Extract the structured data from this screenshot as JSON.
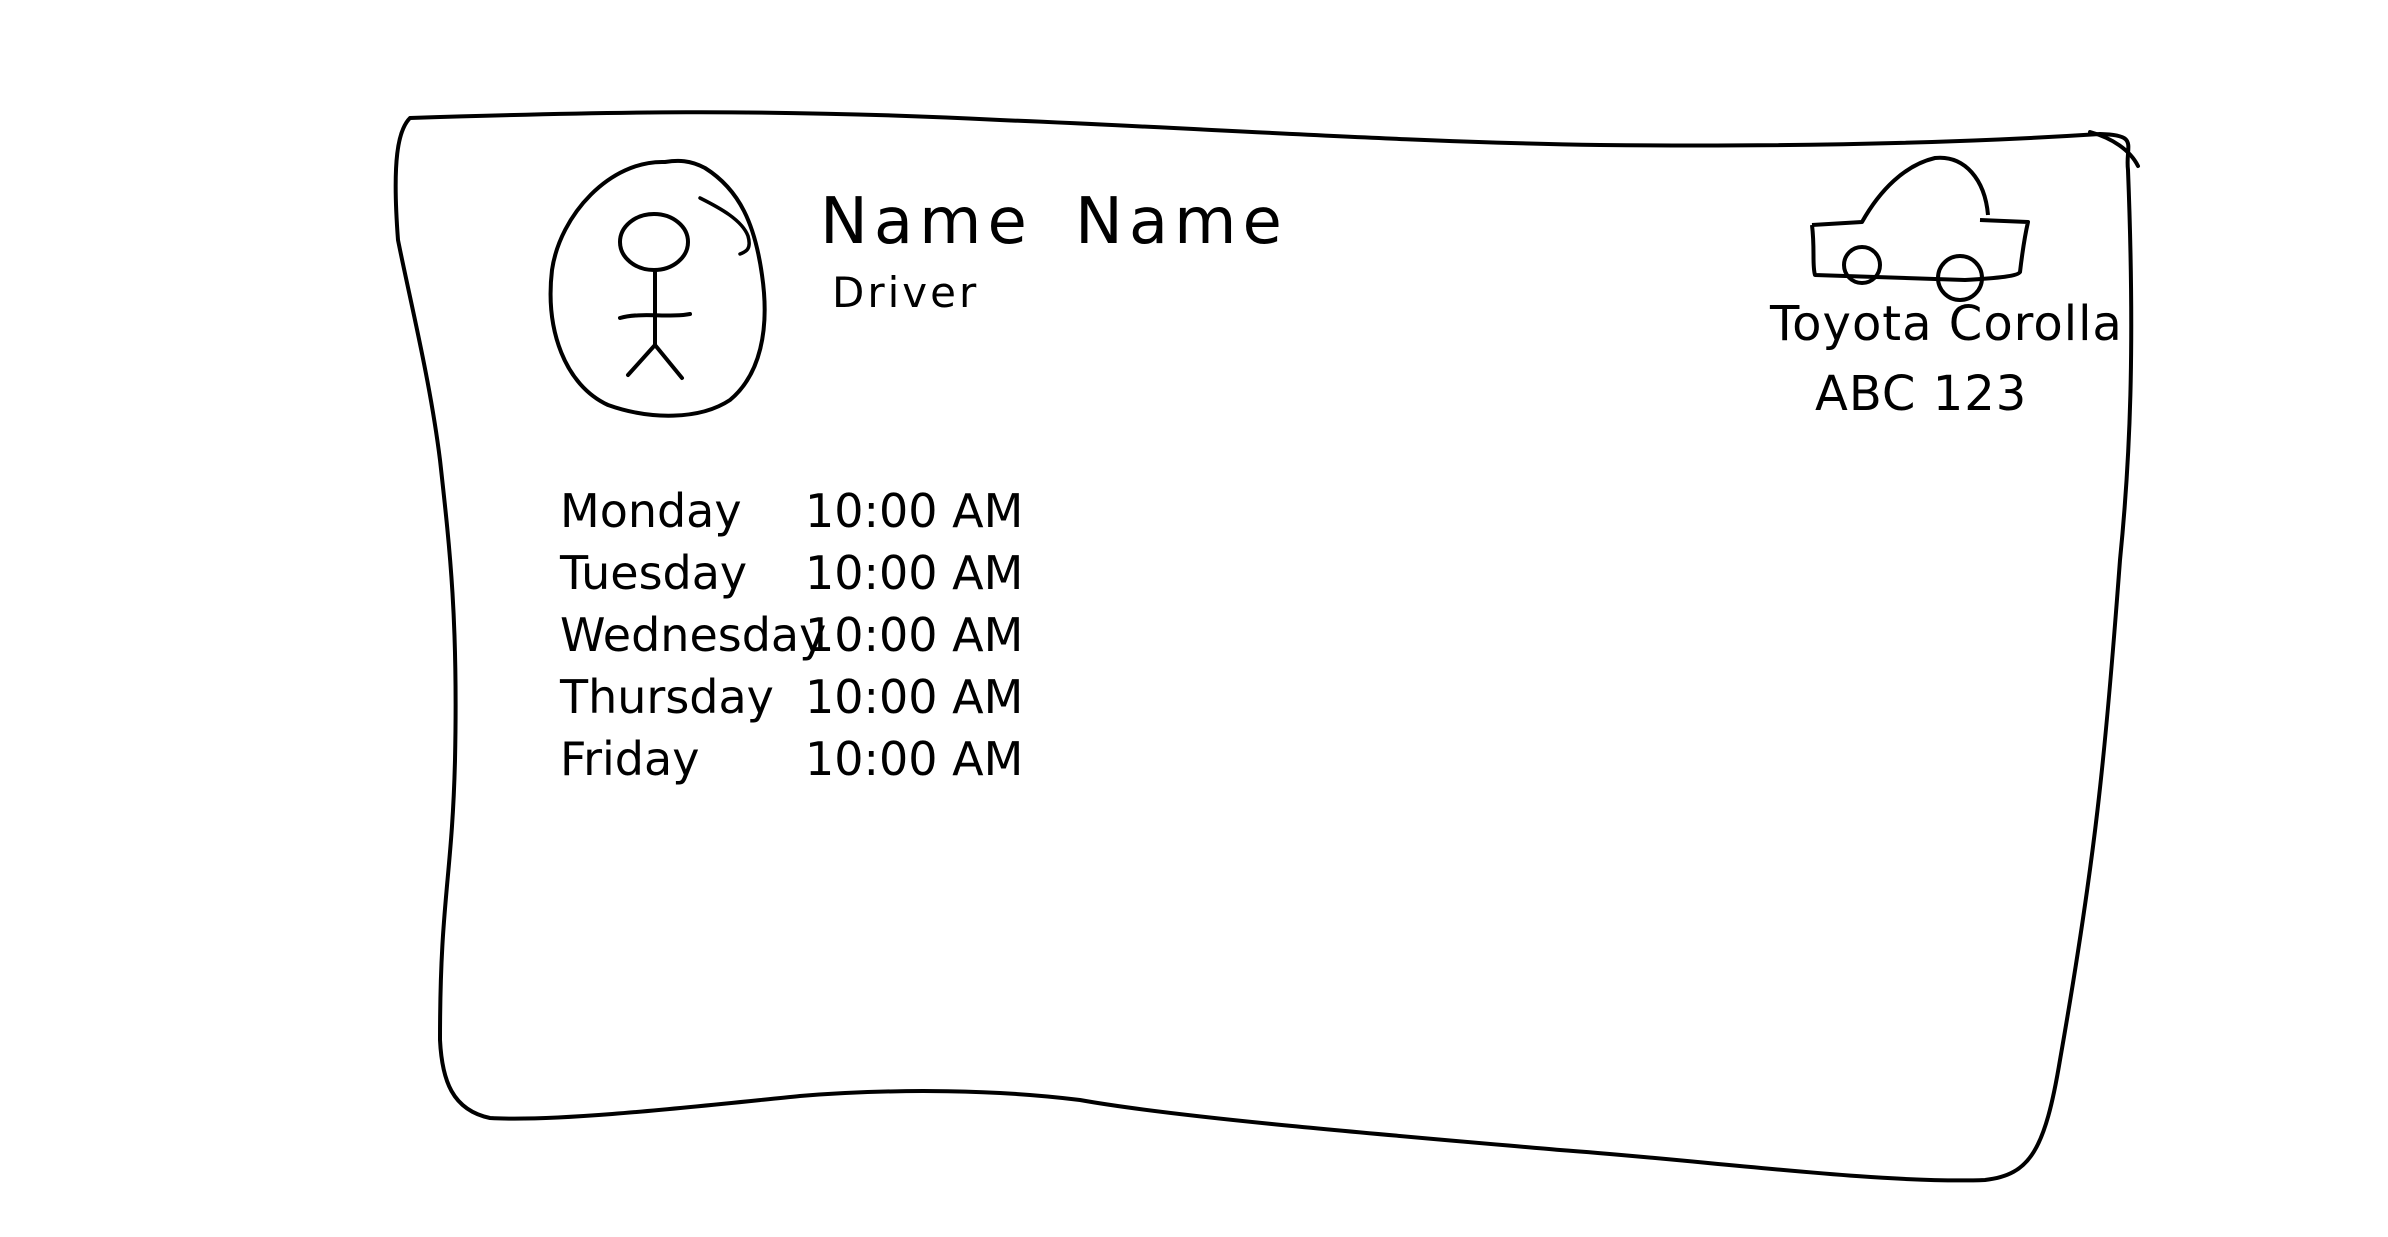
{
  "profile": {
    "first_name": "Name",
    "last_name": "Name",
    "role": "Driver"
  },
  "vehicle": {
    "model": "Toyota Corolla",
    "plate": "ABC 123"
  },
  "schedule": [
    {
      "day": "Monday",
      "time": "10:00 AM"
    },
    {
      "day": "Tuesday",
      "time": "10:00 AM"
    },
    {
      "day": "Wednesday",
      "time": "10:00 AM"
    },
    {
      "day": "Thursday",
      "time": "10:00 AM"
    },
    {
      "day": "Friday",
      "time": "10:00 AM"
    }
  ],
  "icons": {
    "avatar": "person-icon",
    "vehicle": "car-icon"
  },
  "colors": {
    "ink": "#000000",
    "background": "#ffffff"
  }
}
